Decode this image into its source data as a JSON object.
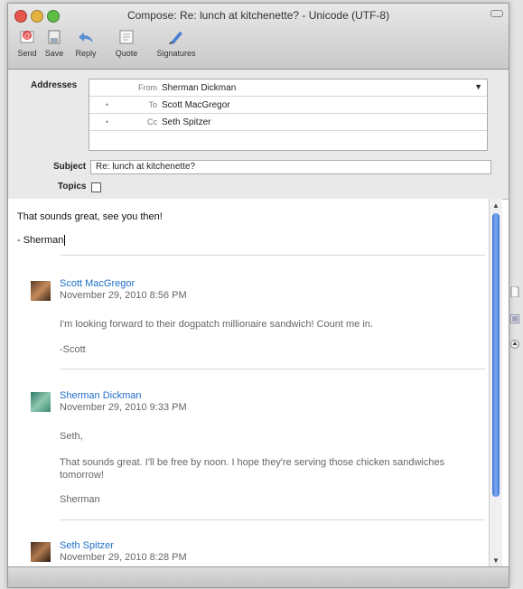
{
  "window": {
    "title": "Compose: Re: lunch at kitchenette? - Unicode (UTF-8)"
  },
  "toolbar": {
    "send": "Send",
    "save": "Save",
    "reply": "Reply",
    "quote": "Quote",
    "signatures": "Signatures"
  },
  "headers": {
    "addresses_label": "Addresses",
    "from_label": "From",
    "from_value": "Sherman Dickman",
    "to_label": "To",
    "to_value": "Scott MacGregor",
    "cc_label": "Cc",
    "cc_value": "Seth Spitzer",
    "subject_label": "Subject",
    "subject_value": "Re: lunch at kitchenette?",
    "topics_label": "Topics"
  },
  "body": {
    "line1": "That sounds great, see you then!",
    "line2": "- Sherman",
    "messages": [
      {
        "sender": "Scott MacGregor",
        "date": "November 29, 2010 8:56 PM",
        "p1": "I'm looking forward to their dogpatch millionaire sandwich! Count me in.",
        "p2": "-Scott"
      },
      {
        "sender": "Sherman Dickman",
        "date": "November 29, 2010 9:33 PM",
        "p1": "Seth,",
        "p2": "That sounds great.  I'll be free by noon.  I hope they're serving those chicken sandwiches tomorrow!",
        "p3": "Sherman"
      },
      {
        "sender": "Seth Spitzer",
        "date": "November 29, 2010 8:28 PM"
      }
    ]
  },
  "colors": {
    "link": "#1f6fc9",
    "scroll_thumb": "#3b73d9"
  }
}
